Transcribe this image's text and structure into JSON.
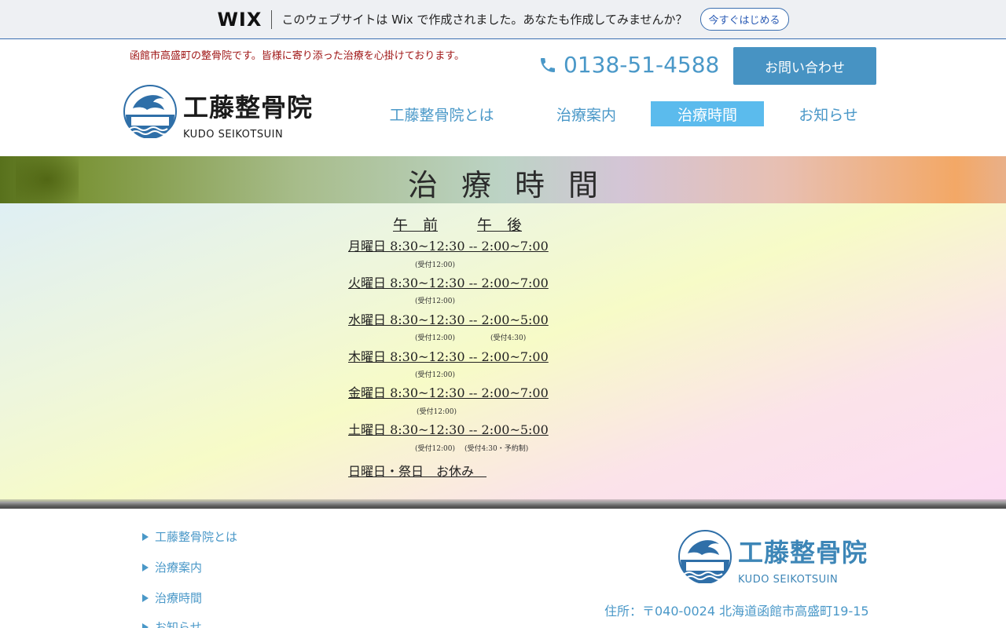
{
  "wix_banner": {
    "logo": "WIX",
    "message": "このウェブサイトは Wix で作成されました。あなたも作成してみませんか？",
    "cta": "今すぐはじめる"
  },
  "header": {
    "tagline": "函館市高盛町の整骨院です。皆様に寄り添った治療を心掛けております。",
    "phone": "0138-51-4588",
    "contact_button": "お問い合わせ",
    "logo": {
      "name_jp": "工藤整骨院",
      "name_en": "KUDO SEIKOTSUIN",
      "mark_text": "KUDO"
    }
  },
  "nav": {
    "items": [
      {
        "label": "工藤整骨院とは",
        "active": false
      },
      {
        "label": "治療案内",
        "active": false
      },
      {
        "label": "治療時間",
        "active": true
      },
      {
        "label": "お知らせ",
        "active": false
      }
    ]
  },
  "page_title": "治療時間",
  "schedule": {
    "header_am": "午　前",
    "header_pm": "午　後",
    "rows": [
      {
        "text": "月曜日 8:30~12:30 -- 2:00~7:00",
        "note_am": "(受付12:00)",
        "note_pm": ""
      },
      {
        "text": "火曜日 8:30~12:30 -- 2:00~7:00",
        "note_am": "(受付12:00)",
        "note_pm": ""
      },
      {
        "text": "水曜日 8:30~12:30 -- 2:00~5:00",
        "note_am": "(受付12:00)",
        "note_pm": "(受付4:30)"
      },
      {
        "text": "木曜日 8:30~12:30 -- 2:00~7:00",
        "note_am": "(受付12:00)",
        "note_pm": ""
      },
      {
        "text": "金曜日 8:30~12:30 -- 2:00~7:00",
        "note_am": "(受付12:00)",
        "note_pm": ""
      },
      {
        "text": "土曜日 8:30~12:30 -- 2:00~5:00",
        "note_am": "(受付12:00)",
        "note_pm": "(受付4:30・予約制)"
      }
    ],
    "closed": "日曜日・祭日　お休み　"
  },
  "footer": {
    "links": [
      "工藤整骨院とは",
      "治療案内",
      "治療時間",
      "お知らせ"
    ],
    "logo": {
      "name_jp": "工藤整骨院",
      "name_en": "KUDO SEIKOTSUIN"
    },
    "address": "住所：〒040-0024 北海道函館市高盛町19-15"
  },
  "colors": {
    "accent": "#4a98c8",
    "button": "#4793c3",
    "nav_active": "#5bbbed",
    "tagline": "#a01818"
  }
}
